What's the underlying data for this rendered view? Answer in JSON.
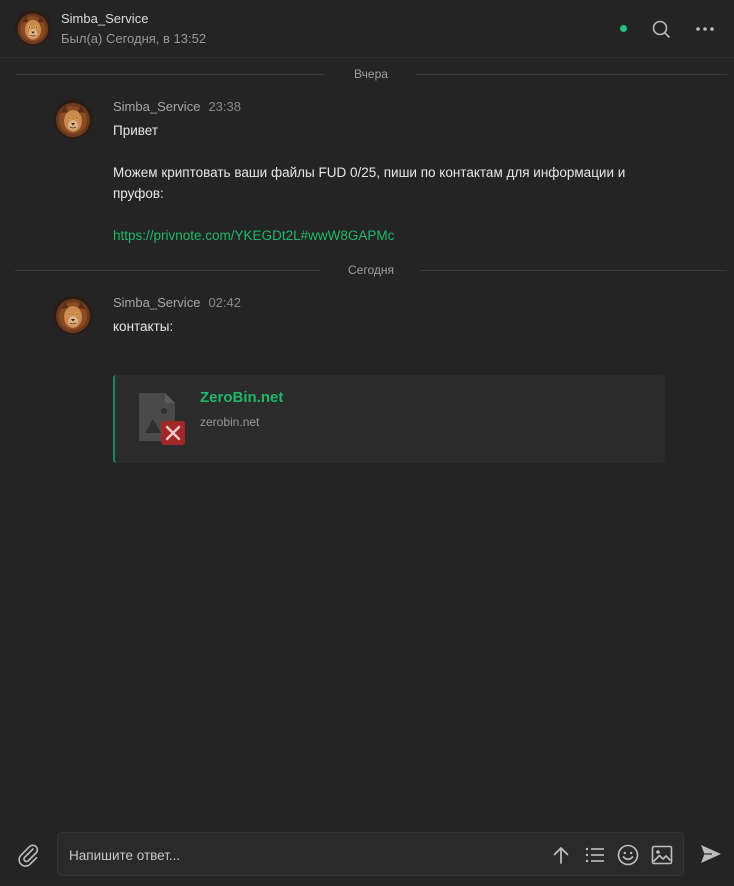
{
  "header": {
    "name": "Simba_Service",
    "status": "Был(а) Сегодня, в 13:52",
    "online_color": "#21c27a",
    "icons": [
      "search-icon",
      "more-icon"
    ]
  },
  "separators": {
    "yesterday": "Вчера",
    "today": "Сегодня"
  },
  "messages": [
    {
      "author": "Simba_Service",
      "time": "23:38",
      "line1": "Привет",
      "line2": "Можем криптовать ваши файлы FUD 0/25, пиши по контактам для информации и",
      "line3": "пруфов:",
      "link": "https://privnote.com/YKEGDt2L#wwW8GAPMc"
    },
    {
      "author": "Simba_Service",
      "time": "02:42",
      "line1": "контакты:",
      "preview": {
        "title": "ZeroBin.net",
        "domain": "zerobin.net",
        "icon": "broken-image-icon"
      }
    }
  ],
  "composer": {
    "placeholder": "Напишите ответ...",
    "icons": [
      "attach-icon",
      "upload-icon",
      "list-icon",
      "emoji-icon",
      "image-icon",
      "send-icon"
    ]
  },
  "colors": {
    "accent": "#1fb86b",
    "background": "#242424"
  }
}
